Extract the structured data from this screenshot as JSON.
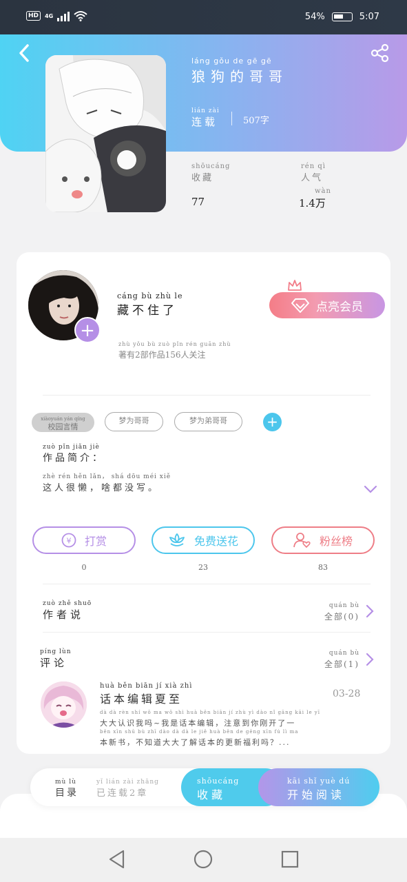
{
  "status_bar": {
    "hd": "HD",
    "network": "4G",
    "battery": "54%",
    "time": "5:07"
  },
  "book": {
    "title": "狼狗的哥哥",
    "title_pinyin": "láng gǒu de gē gē",
    "status": "连载",
    "status_pinyin": "lián zài",
    "word_count": "507字",
    "fav_label": "收藏",
    "fav_pinyin": "shōucáng",
    "fav_value": "77",
    "pop_label": "人气",
    "pop_pinyin": "rén qì",
    "pop_value": "1.4万",
    "pop_unit_pinyin": "wàn"
  },
  "author": {
    "name": "藏不住了",
    "name_pinyin": "cáng bù zhù le",
    "meta": "著有2部作品156人关注",
    "meta_pinyin": "zhù yǒu bù zuò pǐn rén guān zhù",
    "vip_label": "点亮会员"
  },
  "tags": [
    {
      "label": "校园言情",
      "pinyin": "xiàoyuán yán qíng",
      "filled": true
    },
    {
      "label": "梦为哥哥",
      "pinyin": "",
      "filled": false
    },
    {
      "label": "梦为弟哥哥",
      "pinyin": "",
      "filled": false
    }
  ],
  "intro": {
    "label": "作品简介：",
    "label_pinyin": "zuò pǐn jiǎn jiè",
    "text": "这人很懒，啥都没写。",
    "text_pinyin": "zhè rén hěn lǎn， shá dōu méi xiě"
  },
  "actions": [
    {
      "label": "打赏",
      "count": "0",
      "color": "#b58fe6"
    },
    {
      "label": "免费送花",
      "count": "23",
      "color": "#4cc6ec"
    },
    {
      "label": "粉丝榜",
      "count": "83",
      "color": "#ee7d86"
    }
  ],
  "author_says": {
    "label": "作者说",
    "label_pinyin": "zuò zhě shuō",
    "right": "全部(0)",
    "right_pinyin": "quán bù"
  },
  "comments": {
    "label": "评论",
    "label_pinyin": "píng lùn",
    "right": "全部(1)",
    "right_pinyin": "quán bù",
    "items": [
      {
        "name": "话本编辑夏至",
        "name_pinyin": "huà běn biān jí xià zhì",
        "date": "03-28",
        "line1": "大大认识我吗~我是话本编辑，注意到你刚开了一",
        "line1_pinyin": "dà dà rèn shí wǒ ma wǒ shì huà běn biān jí zhù yì dào nǐ gāng kāi le yī",
        "line2": "本新书，不知道大大了解话本的更新福利吗？...",
        "line2_pinyin": "běn xīn shū bù zhī dào dà dà le jiě huà běn de gēng xīn fú lì ma"
      }
    ]
  },
  "bottom_bar": {
    "toc_label": "目录",
    "toc_pinyin": "mù lù",
    "toc_info": "已连载2章",
    "toc_info_pinyin": "yǐ lián zài zhāng",
    "fav_label": "收藏",
    "fav_pinyin": "shōucáng",
    "read_label": "开始阅读",
    "read_pinyin": "kāi shǐ yuè dú"
  },
  "icons": [
    "back-icon",
    "share-icon",
    "crown-icon",
    "diamond-icon",
    "yen-icon",
    "flower-icon",
    "fans-icon",
    "chevron-right-icon",
    "chevron-down-icon",
    "nav-back-icon",
    "nav-home-icon",
    "nav-recents-icon"
  ]
}
